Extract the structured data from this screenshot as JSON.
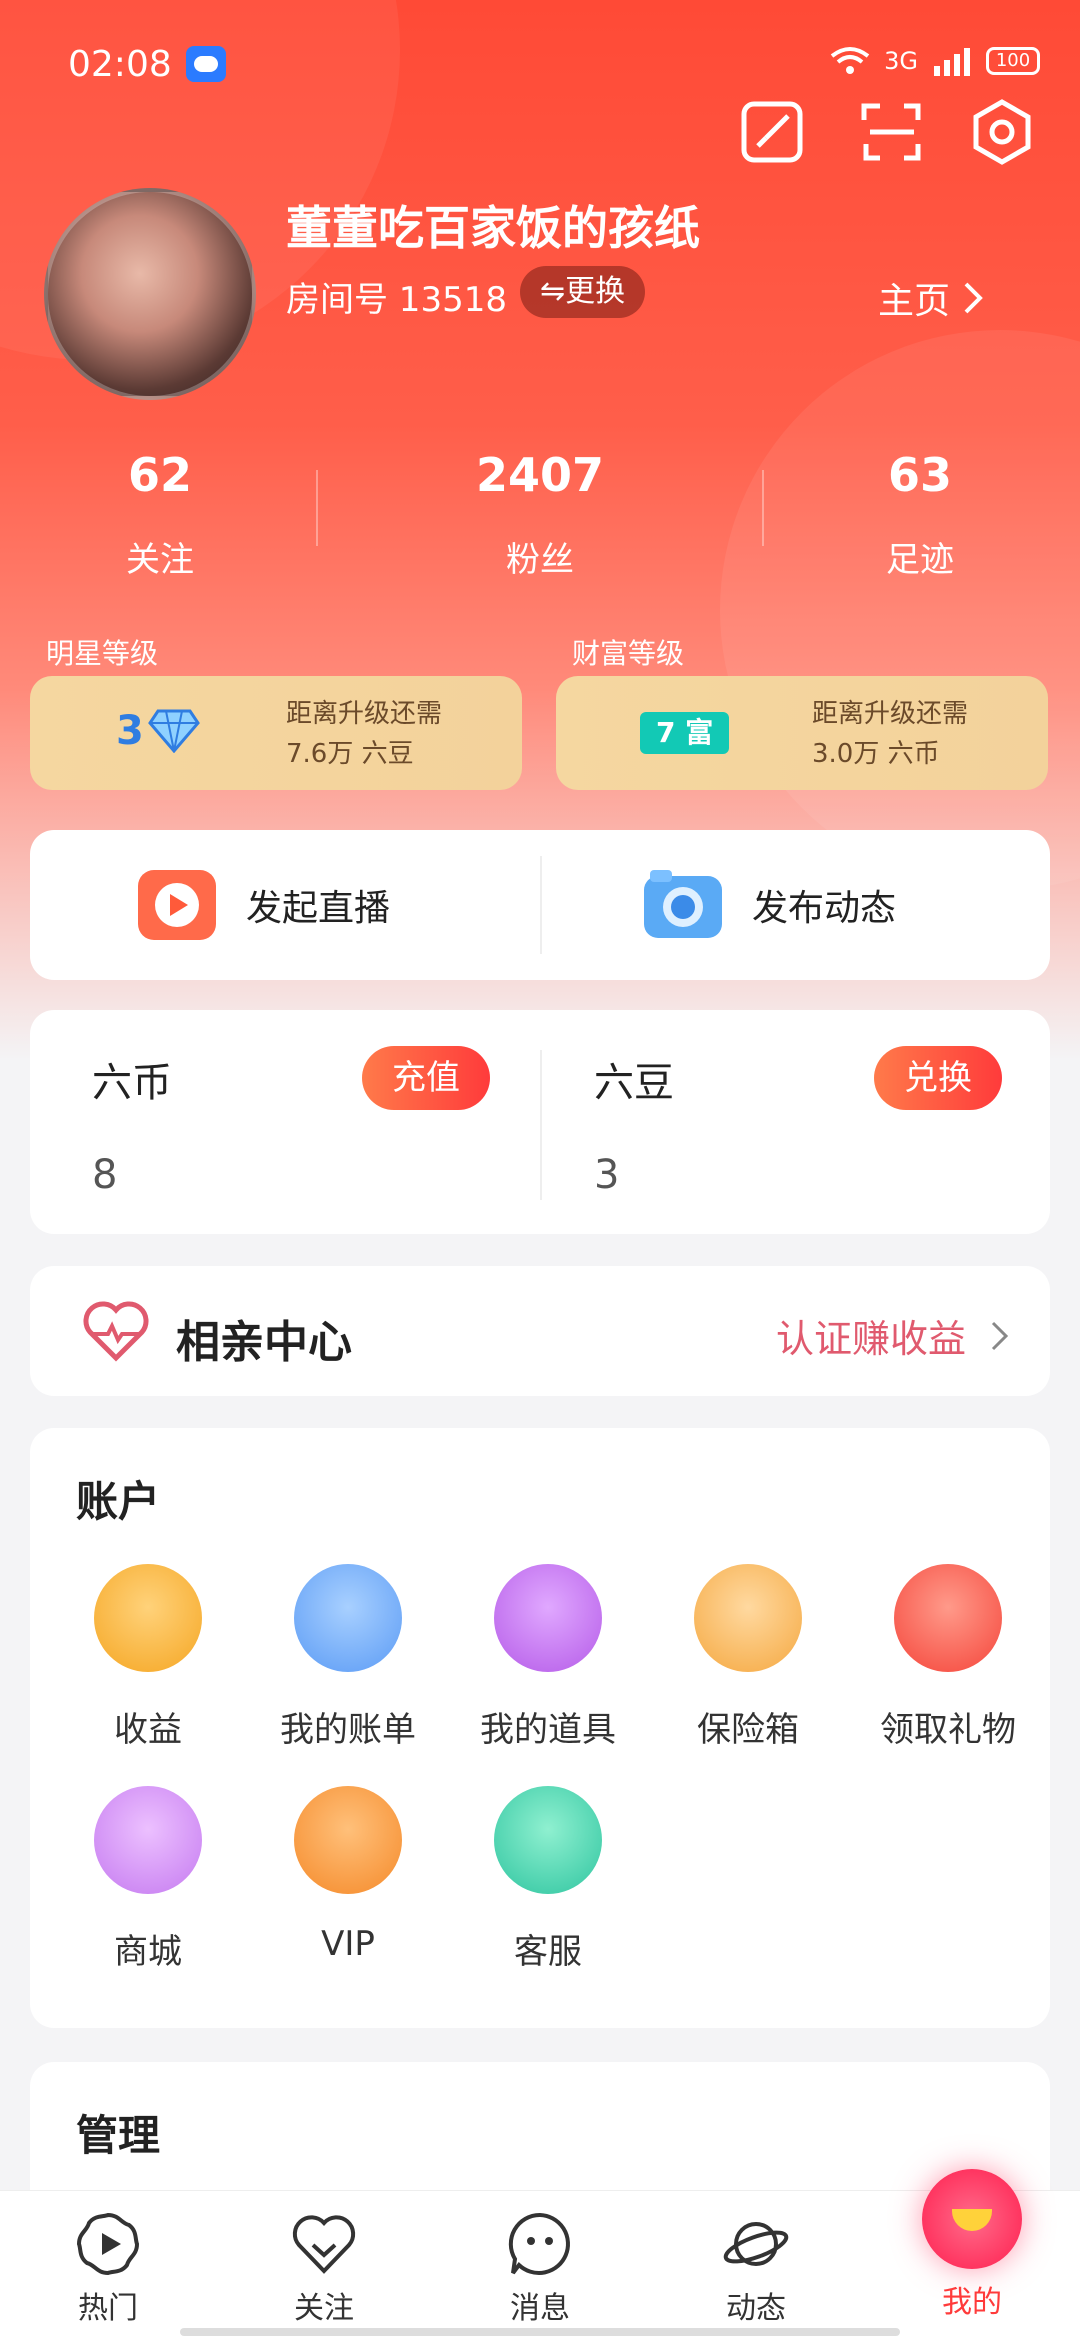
{
  "status": {
    "time": "02:08",
    "network": "3G",
    "battery": "100"
  },
  "profile": {
    "nickname": "董董吃百家饭的孩纸",
    "room_label": "房间号 13518",
    "change_label": "⇋更换",
    "home_label": "主页"
  },
  "stats": [
    {
      "value": "62",
      "label": "关注"
    },
    {
      "value": "2407",
      "label": "粉丝"
    },
    {
      "value": "63",
      "label": "足迹"
    }
  ],
  "levels": {
    "star": {
      "title": "明星等级",
      "level": "3",
      "line1": "距离升级还需",
      "line2": "7.6万 六豆"
    },
    "wealth": {
      "title": "财富等级",
      "badge": "7 富",
      "line1": "距离升级还需",
      "line2": "3.0万 六币"
    }
  },
  "quick": {
    "live_label": "发起直播",
    "post_label": "发布动态"
  },
  "wallet": {
    "coin": {
      "title": "六币",
      "value": "8",
      "button": "充值"
    },
    "bean": {
      "title": "六豆",
      "value": "3",
      "button": "兑换"
    }
  },
  "dating": {
    "title": "相亲中心",
    "action": "认证赚收益"
  },
  "account": {
    "title": "账户",
    "items": [
      {
        "label": "收益",
        "icon": "money-bag-icon",
        "color": "#f5a623"
      },
      {
        "label": "我的账单",
        "icon": "bill-icon",
        "color": "#5b9bf5"
      },
      {
        "label": "我的道具",
        "icon": "wand-icon",
        "color": "#b55be8"
      },
      {
        "label": "保险箱",
        "icon": "safe-icon",
        "color": "#f5a840"
      },
      {
        "label": "领取礼物",
        "icon": "gift-icon",
        "color": "#f5453a"
      },
      {
        "label": "商城",
        "icon": "shopping-bag-icon",
        "color": "#c57af0"
      },
      {
        "label": "VIP",
        "icon": "vip-diamond-icon",
        "color": "#f58a2a"
      },
      {
        "label": "客服",
        "icon": "headset-icon",
        "color": "#2fc5a0"
      }
    ]
  },
  "manage": {
    "title": "管理"
  },
  "tabs": [
    {
      "label": "热门",
      "icon": "play-flower-icon"
    },
    {
      "label": "关注",
      "icon": "heart-icon"
    },
    {
      "label": "消息",
      "icon": "message-face-icon"
    },
    {
      "label": "动态",
      "icon": "planet-icon"
    },
    {
      "label": "我的",
      "icon": "me-bubble-icon",
      "active": true
    }
  ],
  "colors": {
    "brand": "#ff4a36",
    "accent": "#ff3b3b",
    "level_card": "#f5d7a0"
  }
}
